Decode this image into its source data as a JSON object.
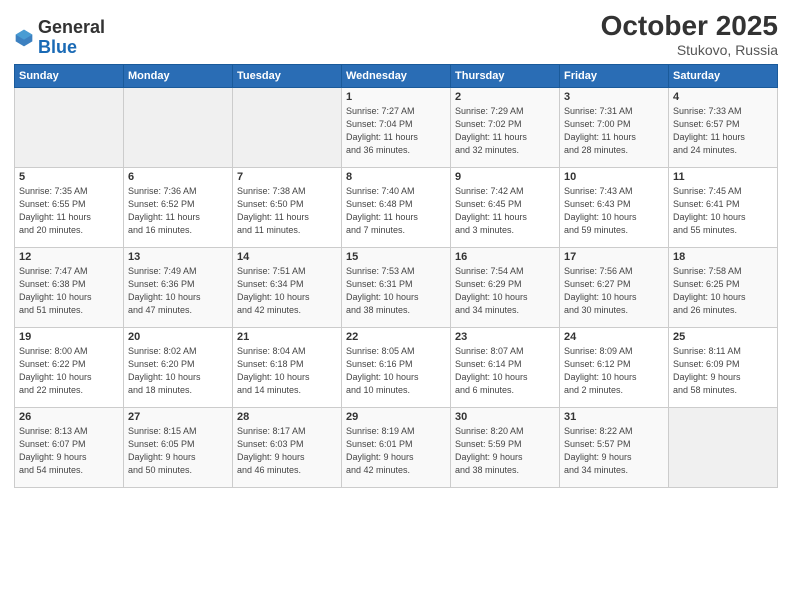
{
  "header": {
    "logo_general": "General",
    "logo_blue": "Blue",
    "month_title": "October 2025",
    "location": "Stukovo, Russia"
  },
  "weekdays": [
    "Sunday",
    "Monday",
    "Tuesday",
    "Wednesday",
    "Thursday",
    "Friday",
    "Saturday"
  ],
  "weeks": [
    [
      {
        "day": "",
        "info": ""
      },
      {
        "day": "",
        "info": ""
      },
      {
        "day": "",
        "info": ""
      },
      {
        "day": "1",
        "info": "Sunrise: 7:27 AM\nSunset: 7:04 PM\nDaylight: 11 hours\nand 36 minutes."
      },
      {
        "day": "2",
        "info": "Sunrise: 7:29 AM\nSunset: 7:02 PM\nDaylight: 11 hours\nand 32 minutes."
      },
      {
        "day": "3",
        "info": "Sunrise: 7:31 AM\nSunset: 7:00 PM\nDaylight: 11 hours\nand 28 minutes."
      },
      {
        "day": "4",
        "info": "Sunrise: 7:33 AM\nSunset: 6:57 PM\nDaylight: 11 hours\nand 24 minutes."
      }
    ],
    [
      {
        "day": "5",
        "info": "Sunrise: 7:35 AM\nSunset: 6:55 PM\nDaylight: 11 hours\nand 20 minutes."
      },
      {
        "day": "6",
        "info": "Sunrise: 7:36 AM\nSunset: 6:52 PM\nDaylight: 11 hours\nand 16 minutes."
      },
      {
        "day": "7",
        "info": "Sunrise: 7:38 AM\nSunset: 6:50 PM\nDaylight: 11 hours\nand 11 minutes."
      },
      {
        "day": "8",
        "info": "Sunrise: 7:40 AM\nSunset: 6:48 PM\nDaylight: 11 hours\nand 7 minutes."
      },
      {
        "day": "9",
        "info": "Sunrise: 7:42 AM\nSunset: 6:45 PM\nDaylight: 11 hours\nand 3 minutes."
      },
      {
        "day": "10",
        "info": "Sunrise: 7:43 AM\nSunset: 6:43 PM\nDaylight: 10 hours\nand 59 minutes."
      },
      {
        "day": "11",
        "info": "Sunrise: 7:45 AM\nSunset: 6:41 PM\nDaylight: 10 hours\nand 55 minutes."
      }
    ],
    [
      {
        "day": "12",
        "info": "Sunrise: 7:47 AM\nSunset: 6:38 PM\nDaylight: 10 hours\nand 51 minutes."
      },
      {
        "day": "13",
        "info": "Sunrise: 7:49 AM\nSunset: 6:36 PM\nDaylight: 10 hours\nand 47 minutes."
      },
      {
        "day": "14",
        "info": "Sunrise: 7:51 AM\nSunset: 6:34 PM\nDaylight: 10 hours\nand 42 minutes."
      },
      {
        "day": "15",
        "info": "Sunrise: 7:53 AM\nSunset: 6:31 PM\nDaylight: 10 hours\nand 38 minutes."
      },
      {
        "day": "16",
        "info": "Sunrise: 7:54 AM\nSunset: 6:29 PM\nDaylight: 10 hours\nand 34 minutes."
      },
      {
        "day": "17",
        "info": "Sunrise: 7:56 AM\nSunset: 6:27 PM\nDaylight: 10 hours\nand 30 minutes."
      },
      {
        "day": "18",
        "info": "Sunrise: 7:58 AM\nSunset: 6:25 PM\nDaylight: 10 hours\nand 26 minutes."
      }
    ],
    [
      {
        "day": "19",
        "info": "Sunrise: 8:00 AM\nSunset: 6:22 PM\nDaylight: 10 hours\nand 22 minutes."
      },
      {
        "day": "20",
        "info": "Sunrise: 8:02 AM\nSunset: 6:20 PM\nDaylight: 10 hours\nand 18 minutes."
      },
      {
        "day": "21",
        "info": "Sunrise: 8:04 AM\nSunset: 6:18 PM\nDaylight: 10 hours\nand 14 minutes."
      },
      {
        "day": "22",
        "info": "Sunrise: 8:05 AM\nSunset: 6:16 PM\nDaylight: 10 hours\nand 10 minutes."
      },
      {
        "day": "23",
        "info": "Sunrise: 8:07 AM\nSunset: 6:14 PM\nDaylight: 10 hours\nand 6 minutes."
      },
      {
        "day": "24",
        "info": "Sunrise: 8:09 AM\nSunset: 6:12 PM\nDaylight: 10 hours\nand 2 minutes."
      },
      {
        "day": "25",
        "info": "Sunrise: 8:11 AM\nSunset: 6:09 PM\nDaylight: 9 hours\nand 58 minutes."
      }
    ],
    [
      {
        "day": "26",
        "info": "Sunrise: 8:13 AM\nSunset: 6:07 PM\nDaylight: 9 hours\nand 54 minutes."
      },
      {
        "day": "27",
        "info": "Sunrise: 8:15 AM\nSunset: 6:05 PM\nDaylight: 9 hours\nand 50 minutes."
      },
      {
        "day": "28",
        "info": "Sunrise: 8:17 AM\nSunset: 6:03 PM\nDaylight: 9 hours\nand 46 minutes."
      },
      {
        "day": "29",
        "info": "Sunrise: 8:19 AM\nSunset: 6:01 PM\nDaylight: 9 hours\nand 42 minutes."
      },
      {
        "day": "30",
        "info": "Sunrise: 8:20 AM\nSunset: 5:59 PM\nDaylight: 9 hours\nand 38 minutes."
      },
      {
        "day": "31",
        "info": "Sunrise: 8:22 AM\nSunset: 5:57 PM\nDaylight: 9 hours\nand 34 minutes."
      },
      {
        "day": "",
        "info": ""
      }
    ]
  ]
}
